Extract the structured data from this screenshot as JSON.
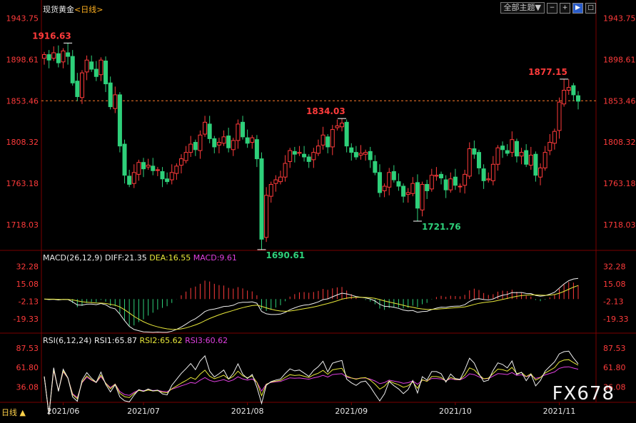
{
  "title": "现货黄金",
  "period": "<日线>",
  "period_button": "日线 ▲",
  "toolbar": {
    "theme_label": "全部主题▼",
    "buttons": [
      "−",
      "+",
      "▶",
      "□"
    ]
  },
  "watermark": "FX678",
  "colors": {
    "up": "#ff3b3b",
    "down": "#2ed07a",
    "diff": "#f0f0f0",
    "dea": "#e8e83a",
    "macd": "#e040e0",
    "rsi1": "#f0f0f0",
    "rsi2": "#e8e83a",
    "rsi3": "#e040e0",
    "axis": "#ff3b3b",
    "grid": "#7a0000"
  },
  "chart_data": [
    {
      "type": "candlestick",
      "yticks": [
        "1943.75",
        "1898.61",
        "1853.46",
        "1808.32",
        "1763.18",
        "1718.03"
      ],
      "ylim": [
        1689,
        1945
      ],
      "xticks": [
        "2021/06",
        "2021/07",
        "2021/08",
        "2021/09",
        "2021/10",
        "2021/11"
      ],
      "reference_line": 1853.46,
      "annotations": [
        {
          "label": "1916.63",
          "value": 1916.63,
          "index": 5
        },
        {
          "label": "1690.61",
          "value": 1690.61,
          "index": 46
        },
        {
          "label": "1834.03",
          "value": 1834.03,
          "index": 63
        },
        {
          "label": "1721.76",
          "value": 1721.76,
          "index": 79
        },
        {
          "label": "1877.15",
          "value": 1877.15,
          "index": 110
        }
      ],
      "closes": [
        1904,
        1898,
        1906,
        1895,
        1908,
        1902,
        1873,
        1858,
        1884,
        1898,
        1888,
        1880,
        1898,
        1872,
        1847,
        1860,
        1804,
        1772,
        1762,
        1775,
        1786,
        1779,
        1783,
        1777,
        1778,
        1768,
        1765,
        1775,
        1782,
        1790,
        1797,
        1806,
        1800,
        1816,
        1830,
        1812,
        1803,
        1808,
        1814,
        1802,
        1810,
        1828,
        1814,
        1807,
        1813,
        1790,
        1702,
        1750,
        1762,
        1767,
        1770,
        1785,
        1799,
        1795,
        1797,
        1792,
        1787,
        1797,
        1804,
        1816,
        1803,
        1822,
        1826,
        1829,
        1804,
        1797,
        1792,
        1796,
        1797,
        1789,
        1775,
        1753,
        1760,
        1775,
        1767,
        1760,
        1749,
        1753,
        1763,
        1736,
        1762,
        1755,
        1772,
        1772,
        1769,
        1756,
        1768,
        1761,
        1760,
        1773,
        1801,
        1795,
        1780,
        1766,
        1768,
        1784,
        1802,
        1800,
        1796,
        1811,
        1793,
        1797,
        1784,
        1794,
        1772,
        1780,
        1797,
        1808,
        1820,
        1852,
        1865,
        1868,
        1860,
        1853
      ]
    },
    {
      "type": "line",
      "title": "MACD(26,12,9)",
      "labels": {
        "diff": "DIFF:21.35",
        "dea": "DEA:16.55",
        "macd": "MACD:9.61"
      },
      "yticks": [
        "32.28",
        "15.08",
        "-2.13",
        "-19.33"
      ],
      "ylim": [
        -30,
        36
      ]
    },
    {
      "type": "line",
      "title": "RSI(6,12,24)",
      "labels": {
        "rsi1": "RSI1:65.87",
        "rsi2": "RSI2:65.62",
        "rsi3": "RSI3:60.62"
      },
      "yticks": [
        "87.53",
        "61.80",
        "36.08"
      ],
      "ylim": [
        18,
        92
      ]
    }
  ]
}
